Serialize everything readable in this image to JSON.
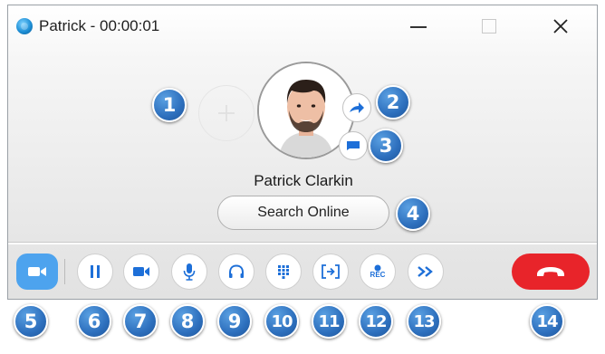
{
  "window": {
    "title": "Patrick - 00:00:01"
  },
  "contact": {
    "name": "Patrick Clarkin",
    "search_label": "Search Online"
  },
  "toolbar": {
    "buttons": [
      {
        "name": "video-toggle",
        "icon": "video-camera-icon"
      },
      {
        "name": "hold",
        "icon": "pause-icon"
      },
      {
        "name": "video",
        "icon": "video-camera-icon"
      },
      {
        "name": "mute",
        "icon": "microphone-icon"
      },
      {
        "name": "audio-device",
        "icon": "headset-icon"
      },
      {
        "name": "dial-pad",
        "icon": "keypad-icon"
      },
      {
        "name": "share-screen",
        "icon": "screen-share-icon"
      },
      {
        "name": "record",
        "icon": "record-icon",
        "label": "REC"
      },
      {
        "name": "transfer",
        "icon": "fast-forward-icon"
      },
      {
        "name": "hang-up",
        "icon": "phone-hangup-icon"
      }
    ]
  },
  "callouts": [
    "1",
    "2",
    "3",
    "4",
    "5",
    "6",
    "7",
    "8",
    "9",
    "10",
    "11",
    "12",
    "13",
    "14"
  ],
  "colors": {
    "accent": "#1d6fd8",
    "video_active": "#4da3ee",
    "hangup": "#e8242a",
    "badge": "#2d6fbd"
  }
}
